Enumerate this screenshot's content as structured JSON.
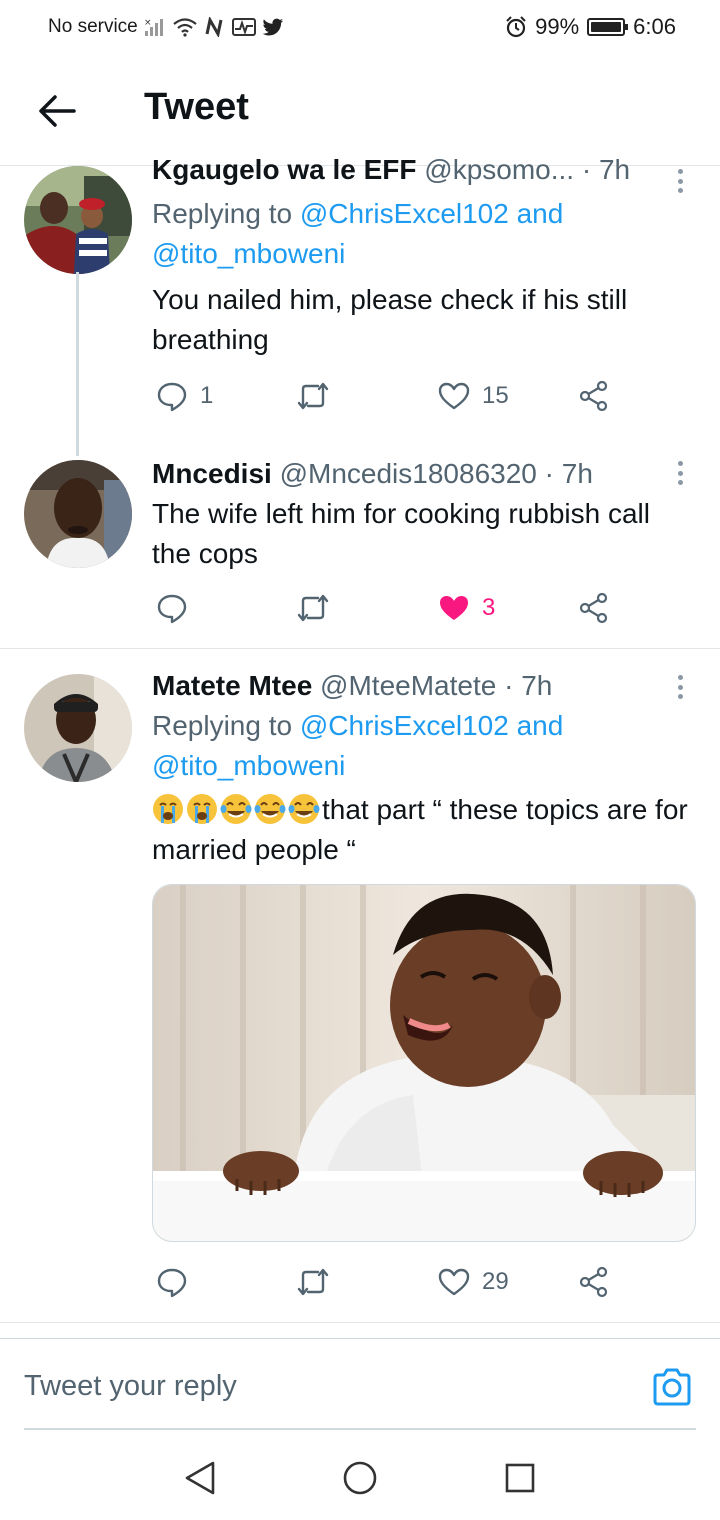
{
  "status_bar": {
    "carrier": "No service",
    "battery": "99%",
    "battery_level": 0.99,
    "time": "6:06"
  },
  "header": {
    "title": "Tweet"
  },
  "tweets": [
    {
      "name": "Kgaugelo wa le EFF",
      "handle": "@kpsomo...",
      "dot": "·",
      "time": "7h",
      "reply_prefix": "Replying to",
      "reply_user1": "@ChrisExcel102",
      "reply_and": "and",
      "reply_user2": "@tito_mboweni",
      "text": "You nailed him, please check if his still breathing",
      "reply_count": "1",
      "retweet_count": "",
      "like_count": "15"
    },
    {
      "name": "Mncedisi",
      "handle": "@Mncedis18086320",
      "dot": "·",
      "time": "7h",
      "text": "The wife left him for cooking rubbish call the cops",
      "reply_count": "",
      "retweet_count": "",
      "like_count": "3",
      "liked": true
    },
    {
      "name": "Matete Mtee",
      "handle": "@MteeMatete",
      "dot": "·",
      "time": "7h",
      "reply_prefix": "Replying to",
      "reply_user1": "@ChrisExcel102",
      "reply_and": "and",
      "reply_user2": "@tito_mboweni",
      "emojis": [
        "crying-face",
        "crying-face",
        "tears-of-joy",
        "tears-of-joy",
        "tears-of-joy"
      ],
      "text": "that part “ these topics are for married people “",
      "reply_count": "",
      "retweet_count": "",
      "like_count": "29"
    }
  ],
  "composer": {
    "placeholder": "Tweet your reply"
  },
  "colors": {
    "link": "#1d9bf0",
    "like": "#f91880",
    "secondary_text": "#536471"
  }
}
